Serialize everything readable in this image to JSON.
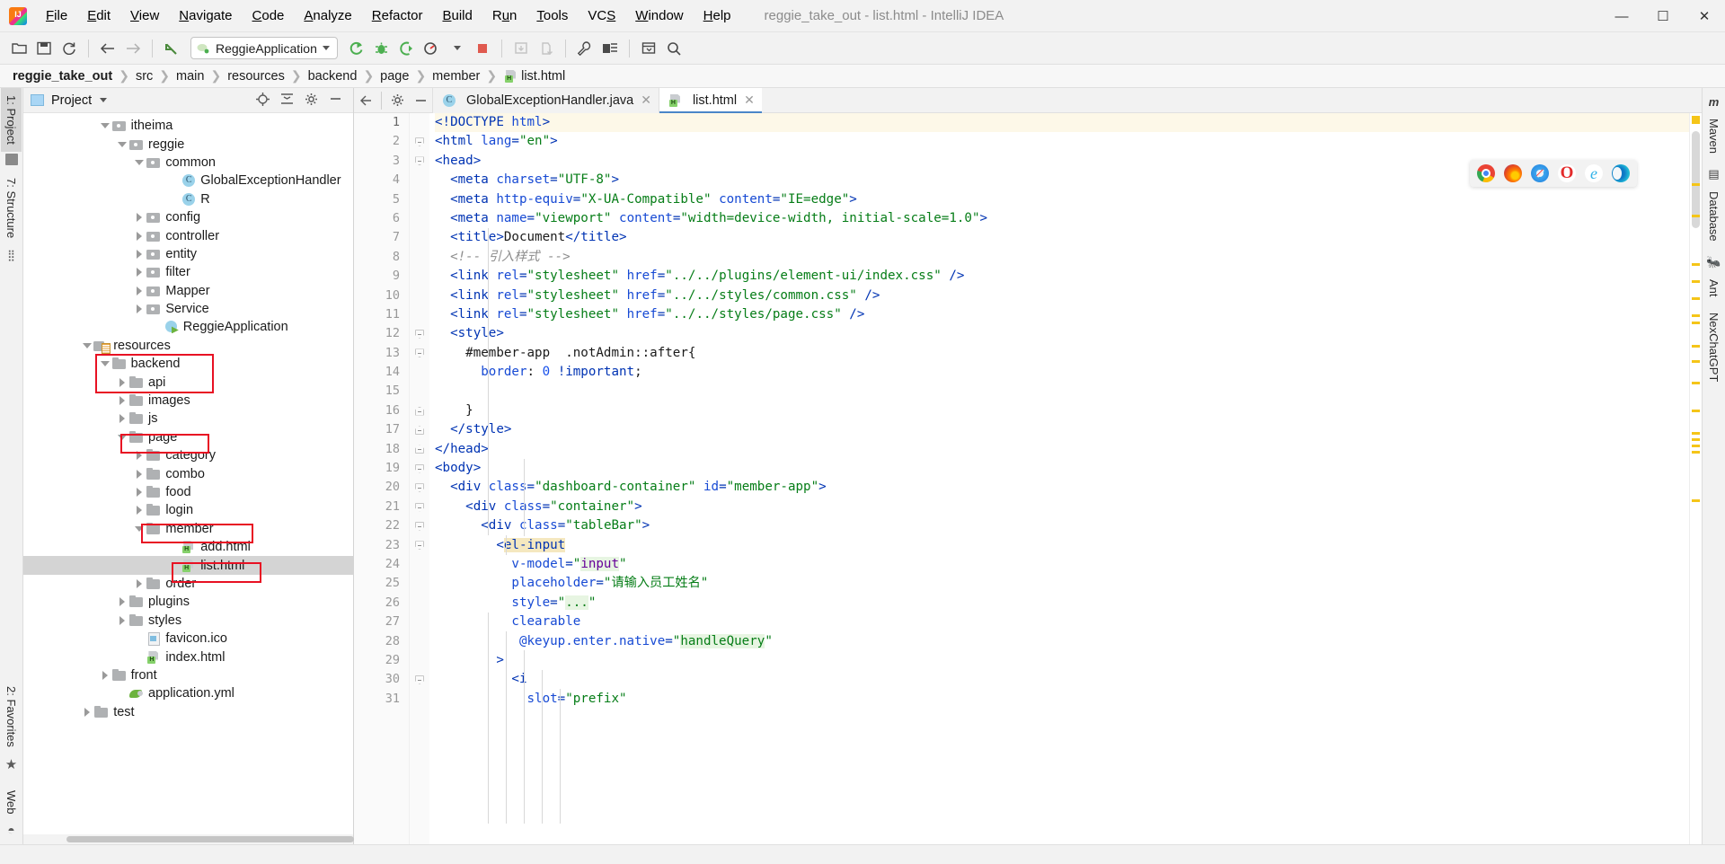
{
  "window": {
    "title": "reggie_take_out - list.html - IntelliJ IDEA",
    "app_icon": "intellij-idea-logo",
    "minimize": "—",
    "maximize": "☐",
    "close": "✕"
  },
  "menubar": [
    {
      "label": "File",
      "mnemonic": "F"
    },
    {
      "label": "Edit",
      "mnemonic": "E"
    },
    {
      "label": "View",
      "mnemonic": "V"
    },
    {
      "label": "Navigate",
      "mnemonic": "N"
    },
    {
      "label": "Code",
      "mnemonic": "C"
    },
    {
      "label": "Analyze",
      "mnemonic": "A"
    },
    {
      "label": "Refactor",
      "mnemonic": "R"
    },
    {
      "label": "Build",
      "mnemonic": "B"
    },
    {
      "label": "Run",
      "mnemonic": "u"
    },
    {
      "label": "Tools",
      "mnemonic": "T"
    },
    {
      "label": "VCS",
      "mnemonic": "S"
    },
    {
      "label": "Window",
      "mnemonic": "W"
    },
    {
      "label": "Help",
      "mnemonic": "H"
    }
  ],
  "toolbar": {
    "run_configuration": "ReggieApplication",
    "buttons": [
      "open-folder-icon",
      "save-all-icon",
      "sync-icon",
      "back-arrow-icon",
      "forward-arrow-icon",
      "undo-icon",
      "rerun-icon",
      "debug-icon",
      "run-with-coverage-icon",
      "profile-icon",
      "stop-icon",
      "update-project-icon",
      "commit-icon",
      "settings-wrench-icon",
      "project-structure-icon",
      "select-in-icon",
      "search-everywhere-icon"
    ]
  },
  "breadcrumb": {
    "items": [
      "reggie_take_out",
      "src",
      "main",
      "resources",
      "backend",
      "page",
      "member",
      "list.html"
    ],
    "separator": "❯"
  },
  "left_strip": {
    "items": [
      {
        "label": "1: Project",
        "mnemonic": "1",
        "active": true
      },
      {
        "label": "7: Structure",
        "mnemonic": "7",
        "active": false
      },
      {
        "label": "2: Favorites",
        "mnemonic": "2",
        "active": false
      },
      {
        "label": "Web",
        "mnemonic": "",
        "active": false
      }
    ]
  },
  "right_strip": {
    "items": [
      "Maven",
      "Database",
      "Ant",
      "NexChatGPT"
    ]
  },
  "project_panel": {
    "title": "Project",
    "actions": [
      "locate-icon",
      "collapse-all-icon",
      "settings-gear-icon",
      "hide-icon"
    ],
    "tree": [
      {
        "label": "itheima",
        "depth": 4,
        "state": "open",
        "icon": "pkg"
      },
      {
        "label": "reggie",
        "depth": 5,
        "state": "open",
        "icon": "pkg"
      },
      {
        "label": "common",
        "depth": 6,
        "state": "open",
        "icon": "pkg"
      },
      {
        "label": "GlobalExceptionHandler",
        "depth": 8,
        "state": "leaf",
        "icon": "cls"
      },
      {
        "label": "R",
        "depth": 8,
        "state": "leaf",
        "icon": "cls"
      },
      {
        "label": "config",
        "depth": 6,
        "state": "closed",
        "icon": "pkg"
      },
      {
        "label": "controller",
        "depth": 6,
        "state": "closed",
        "icon": "pkg"
      },
      {
        "label": "entity",
        "depth": 6,
        "state": "closed",
        "icon": "pkg"
      },
      {
        "label": "filter",
        "depth": 6,
        "state": "closed",
        "icon": "pkg"
      },
      {
        "label": "Mapper",
        "depth": 6,
        "state": "closed",
        "icon": "pkg"
      },
      {
        "label": "Service",
        "depth": 6,
        "state": "closed",
        "icon": "pkg"
      },
      {
        "label": "ReggieApplication",
        "depth": 7,
        "state": "leaf",
        "icon": "spring"
      },
      {
        "label": "resources",
        "depth": 3,
        "state": "open",
        "icon": "res",
        "highlight": true
      },
      {
        "label": "backend",
        "depth": 4,
        "state": "open",
        "icon": "folder",
        "highlight": true
      },
      {
        "label": "api",
        "depth": 5,
        "state": "closed",
        "icon": "folder"
      },
      {
        "label": "images",
        "depth": 5,
        "state": "closed",
        "icon": "folder"
      },
      {
        "label": "js",
        "depth": 5,
        "state": "closed",
        "icon": "folder"
      },
      {
        "label": "page",
        "depth": 5,
        "state": "open",
        "icon": "folder",
        "highlight": true
      },
      {
        "label": "category",
        "depth": 6,
        "state": "closed",
        "icon": "folder"
      },
      {
        "label": "combo",
        "depth": 6,
        "state": "closed",
        "icon": "folder"
      },
      {
        "label": "food",
        "depth": 6,
        "state": "closed",
        "icon": "folder"
      },
      {
        "label": "login",
        "depth": 6,
        "state": "closed",
        "icon": "folder"
      },
      {
        "label": "member",
        "depth": 6,
        "state": "open",
        "icon": "folder",
        "highlight": true
      },
      {
        "label": "add.html",
        "depth": 8,
        "state": "leaf",
        "icon": "html"
      },
      {
        "label": "list.html",
        "depth": 8,
        "state": "leaf",
        "icon": "html",
        "selected": true,
        "highlight": true
      },
      {
        "label": "order",
        "depth": 6,
        "state": "closed",
        "icon": "folder"
      },
      {
        "label": "plugins",
        "depth": 5,
        "state": "closed",
        "icon": "folder"
      },
      {
        "label": "styles",
        "depth": 5,
        "state": "closed",
        "icon": "folder"
      },
      {
        "label": "favicon.ico",
        "depth": 6,
        "state": "leaf",
        "icon": "img"
      },
      {
        "label": "index.html",
        "depth": 6,
        "state": "leaf",
        "icon": "html"
      },
      {
        "label": "front",
        "depth": 4,
        "state": "closed",
        "icon": "folder"
      },
      {
        "label": "application.yml",
        "depth": 5,
        "state": "leaf",
        "icon": "yml"
      },
      {
        "label": "test",
        "depth": 3,
        "state": "closed",
        "icon": "folder"
      }
    ]
  },
  "editor": {
    "tabs": [
      {
        "label": "GlobalExceptionHandler.java",
        "icon": "java-class-icon",
        "active": false,
        "close": "✕"
      },
      {
        "label": "list.html",
        "icon": "html-file-icon",
        "active": true,
        "close": "✕"
      }
    ],
    "toolstrip": [
      "select-opened-file-icon",
      "settings-gear-icon",
      "hide-icon"
    ],
    "first_line": 1,
    "lines": [
      {
        "n": 1,
        "fold": "none",
        "hl": true,
        "tokens": [
          {
            "t": "tag",
            "v": "&lt;!DOCTYPE "
          },
          {
            "t": "attr",
            "v": "html"
          },
          {
            "t": "tag",
            "v": "&gt;"
          }
        ]
      },
      {
        "n": 2,
        "fold": "open",
        "tokens": [
          {
            "t": "tag",
            "v": "&lt;html "
          },
          {
            "t": "attr",
            "v": "lang"
          },
          {
            "t": "tag",
            "v": "="
          },
          {
            "t": "str",
            "v": "\"en\""
          },
          {
            "t": "tag",
            "v": "&gt;"
          }
        ]
      },
      {
        "n": 3,
        "fold": "open",
        "tokens": [
          {
            "t": "tag",
            "v": "&lt;head&gt;"
          }
        ]
      },
      {
        "n": 4,
        "fold": "none",
        "tokens": [
          {
            "t": "tag",
            "v": "  &lt;meta "
          },
          {
            "t": "attr",
            "v": "charset"
          },
          {
            "t": "tag",
            "v": "="
          },
          {
            "t": "str",
            "v": "\"UTF-8\""
          },
          {
            "t": "tag",
            "v": "&gt;"
          }
        ]
      },
      {
        "n": 5,
        "fold": "none",
        "tokens": [
          {
            "t": "tag",
            "v": "  &lt;meta "
          },
          {
            "t": "attr",
            "v": "http-equiv"
          },
          {
            "t": "tag",
            "v": "="
          },
          {
            "t": "str",
            "v": "\"X-UA-Compatible\""
          },
          {
            "t": "tag",
            "v": " "
          },
          {
            "t": "attr",
            "v": "content"
          },
          {
            "t": "tag",
            "v": "="
          },
          {
            "t": "str",
            "v": "\"IE=edge\""
          },
          {
            "t": "tag",
            "v": "&gt;"
          }
        ]
      },
      {
        "n": 6,
        "fold": "none",
        "tokens": [
          {
            "t": "tag",
            "v": "  &lt;meta "
          },
          {
            "t": "attr",
            "v": "name"
          },
          {
            "t": "tag",
            "v": "="
          },
          {
            "t": "str",
            "v": "\"viewport\""
          },
          {
            "t": "tag",
            "v": " "
          },
          {
            "t": "attr",
            "v": "content"
          },
          {
            "t": "tag",
            "v": "="
          },
          {
            "t": "str",
            "v": "\"width=device-width, initial-scale=1.0\""
          },
          {
            "t": "tag",
            "v": "&gt;"
          }
        ]
      },
      {
        "n": 7,
        "fold": "none",
        "tokens": [
          {
            "t": "tag",
            "v": "  &lt;title&gt;"
          },
          {
            "t": "txt",
            "v": "Document"
          },
          {
            "t": "tag",
            "v": "&lt;/title&gt;"
          }
        ]
      },
      {
        "n": 8,
        "fold": "none",
        "tokens": [
          {
            "t": "cmt",
            "v": "  &lt;!-- 引入样式 --&gt;"
          }
        ]
      },
      {
        "n": 9,
        "fold": "none",
        "tokens": [
          {
            "t": "tag",
            "v": "  &lt;link "
          },
          {
            "t": "attr",
            "v": "rel"
          },
          {
            "t": "tag",
            "v": "="
          },
          {
            "t": "str",
            "v": "\"stylesheet\""
          },
          {
            "t": "tag",
            "v": " "
          },
          {
            "t": "attr",
            "v": "href"
          },
          {
            "t": "tag",
            "v": "="
          },
          {
            "t": "str",
            "v": "\"../../plugins/element-ui/index.css\""
          },
          {
            "t": "tag",
            "v": " /&gt;"
          }
        ]
      },
      {
        "n": 10,
        "fold": "none",
        "tokens": [
          {
            "t": "tag",
            "v": "  &lt;link "
          },
          {
            "t": "attr",
            "v": "rel"
          },
          {
            "t": "tag",
            "v": "="
          },
          {
            "t": "str",
            "v": "\"stylesheet\""
          },
          {
            "t": "tag",
            "v": " "
          },
          {
            "t": "attr",
            "v": "href"
          },
          {
            "t": "tag",
            "v": "="
          },
          {
            "t": "str",
            "v": "\"../../styles/common.css\""
          },
          {
            "t": "tag",
            "v": " /&gt;"
          }
        ]
      },
      {
        "n": 11,
        "fold": "none",
        "tokens": [
          {
            "t": "tag",
            "v": "  &lt;link "
          },
          {
            "t": "attr",
            "v": "rel"
          },
          {
            "t": "tag",
            "v": "="
          },
          {
            "t": "str",
            "v": "\"stylesheet\""
          },
          {
            "t": "tag",
            "v": " "
          },
          {
            "t": "attr",
            "v": "href"
          },
          {
            "t": "tag",
            "v": "="
          },
          {
            "t": "str",
            "v": "\"../../styles/page.css\""
          },
          {
            "t": "tag",
            "v": " /&gt;"
          }
        ]
      },
      {
        "n": 12,
        "fold": "open",
        "tokens": [
          {
            "t": "tag",
            "v": "  &lt;style&gt;"
          }
        ]
      },
      {
        "n": 13,
        "fold": "open",
        "tokens": [
          {
            "t": "txt",
            "v": "    #member-app  .notAdmin::after{"
          }
        ]
      },
      {
        "n": 14,
        "fold": "none",
        "tokens": [
          {
            "t": "prop",
            "v": "      border"
          },
          {
            "t": "txt",
            "v": ": "
          },
          {
            "t": "num",
            "v": "0"
          },
          {
            "t": "txt",
            "v": " "
          },
          {
            "t": "val",
            "v": "!important"
          },
          {
            "t": "txt",
            "v": ";"
          }
        ]
      },
      {
        "n": 15,
        "fold": "none",
        "tokens": []
      },
      {
        "n": 16,
        "fold": "close",
        "tokens": [
          {
            "t": "txt",
            "v": "    }"
          }
        ]
      },
      {
        "n": 17,
        "fold": "close",
        "tokens": [
          {
            "t": "tag",
            "v": "  &lt;/style&gt;"
          }
        ]
      },
      {
        "n": 18,
        "fold": "close",
        "tokens": [
          {
            "t": "tag",
            "v": "&lt;/head&gt;"
          }
        ]
      },
      {
        "n": 19,
        "fold": "open",
        "tokens": [
          {
            "t": "tag",
            "v": "&lt;body&gt;"
          }
        ]
      },
      {
        "n": 20,
        "fold": "open",
        "tokens": [
          {
            "t": "tag",
            "v": "  &lt;div "
          },
          {
            "t": "attr",
            "v": "class"
          },
          {
            "t": "tag",
            "v": "="
          },
          {
            "t": "str",
            "v": "\"dashboard-container\""
          },
          {
            "t": "tag",
            "v": " "
          },
          {
            "t": "attr",
            "v": "id"
          },
          {
            "t": "tag",
            "v": "="
          },
          {
            "t": "str",
            "v": "\"member-app\""
          },
          {
            "t": "tag",
            "v": "&gt;"
          }
        ]
      },
      {
        "n": 21,
        "fold": "open",
        "tokens": [
          {
            "t": "tag",
            "v": "    &lt;div "
          },
          {
            "t": "attr",
            "v": "class"
          },
          {
            "t": "tag",
            "v": "="
          },
          {
            "t": "str",
            "v": "\"container\""
          },
          {
            "t": "tag",
            "v": "&gt;"
          }
        ]
      },
      {
        "n": 22,
        "fold": "open",
        "tokens": [
          {
            "t": "tag",
            "v": "      &lt;div "
          },
          {
            "t": "attr",
            "v": "class"
          },
          {
            "t": "tag",
            "v": "="
          },
          {
            "t": "str",
            "v": "\"tableBar\""
          },
          {
            "t": "tag",
            "v": "&gt;"
          }
        ]
      },
      {
        "n": 23,
        "fold": "open",
        "tokens": [
          {
            "t": "tag",
            "v": "        &lt;"
          },
          {
            "t": "tag-hl",
            "v": "el-input"
          }
        ]
      },
      {
        "n": 24,
        "fold": "none",
        "tokens": [
          {
            "t": "attr",
            "v": "          v-model"
          },
          {
            "t": "tag",
            "v": "="
          },
          {
            "t": "str",
            "v": "\""
          },
          {
            "t": "vue-hl",
            "v": "input"
          },
          {
            "t": "str",
            "v": "\""
          }
        ]
      },
      {
        "n": 25,
        "fold": "none",
        "tokens": [
          {
            "t": "attr",
            "v": "          placeholder"
          },
          {
            "t": "tag",
            "v": "="
          },
          {
            "t": "str",
            "v": "\"请输入员工姓名\""
          }
        ]
      },
      {
        "n": 26,
        "fold": "none",
        "tokens": [
          {
            "t": "attr",
            "v": "          style"
          },
          {
            "t": "tag",
            "v": "="
          },
          {
            "t": "str",
            "v": "\""
          },
          {
            "t": "str-hl",
            "v": "..."
          },
          {
            "t": "str",
            "v": "\""
          }
        ]
      },
      {
        "n": 27,
        "fold": "none",
        "tokens": [
          {
            "t": "attr",
            "v": "          clearable"
          }
        ]
      },
      {
        "n": 28,
        "fold": "none",
        "tokens": [
          {
            "t": "attr",
            "v": "           @keyup.enter.native"
          },
          {
            "t": "tag",
            "v": "="
          },
          {
            "t": "str",
            "v": "\""
          },
          {
            "t": "str-hl",
            "v": "handleQuery"
          },
          {
            "t": "str",
            "v": "\""
          }
        ]
      },
      {
        "n": 29,
        "fold": "none",
        "tokens": [
          {
            "t": "tag",
            "v": "        &gt;"
          }
        ]
      },
      {
        "n": 30,
        "fold": "open",
        "tokens": [
          {
            "t": "tag",
            "v": "          &lt;i"
          }
        ]
      },
      {
        "n": 31,
        "fold": "none",
        "tokens": [
          {
            "t": "attr",
            "v": "            slot"
          },
          {
            "t": "tag",
            "v": "="
          },
          {
            "t": "str",
            "v": "\"prefix\""
          }
        ]
      }
    ],
    "browser_popup": {
      "browsers": [
        "chrome-icon",
        "firefox-icon",
        "safari-icon",
        "opera-icon",
        "internet-explorer-icon",
        "edge-icon"
      ]
    }
  },
  "colors": {
    "accent": "#4a86c8",
    "highlight_box": "#e81123",
    "marker": "#f5c518",
    "selection": "#d4d4d4"
  }
}
